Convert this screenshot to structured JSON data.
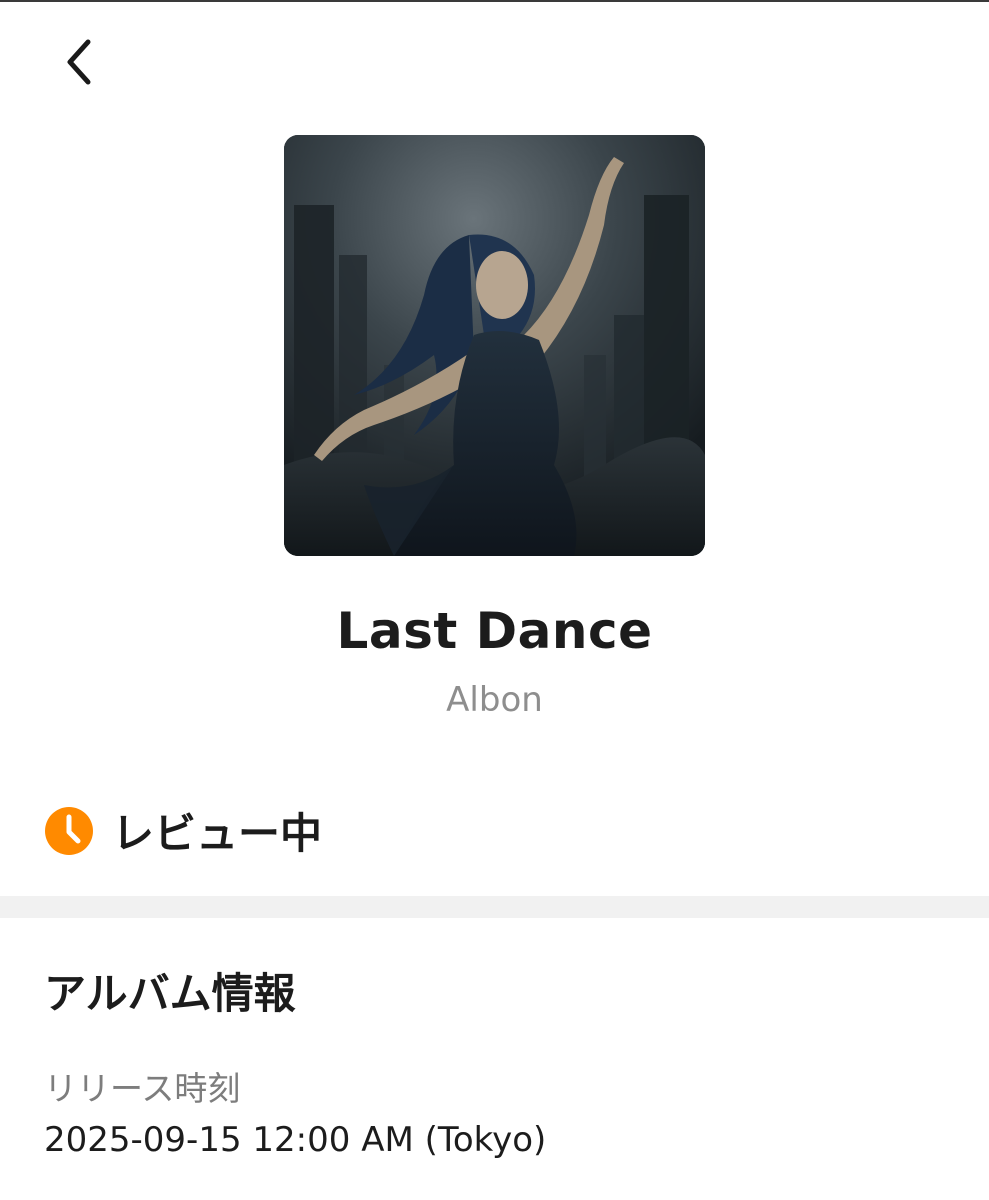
{
  "header": {
    "back_icon": "chevron-left-icon"
  },
  "album": {
    "title": "Last Dance",
    "artist": "Albon",
    "artwork_description_icon": "album-artwork"
  },
  "status": {
    "icon": "clock-icon",
    "label": "レビュー中",
    "color": "#FF8A00"
  },
  "info_section": {
    "title": "アルバム情報",
    "release_label": "リリース時刻",
    "release_value": "2025-09-15 12:00 AM (Tokyo)"
  }
}
